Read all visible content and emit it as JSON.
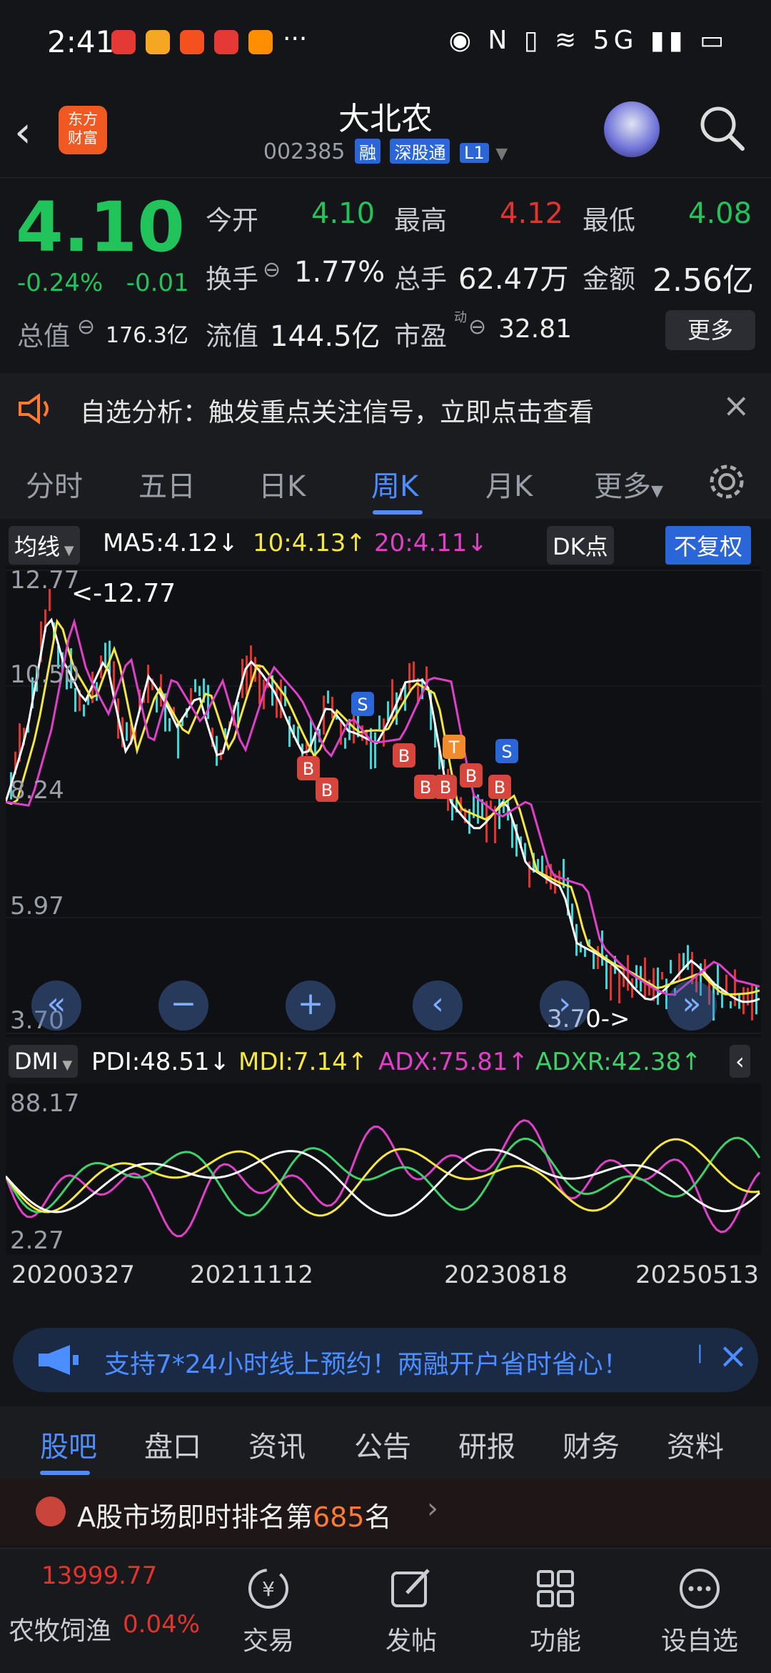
{
  "status": {
    "time": "2:41",
    "icons": "◉ N ▯ ≋ 5G ▮▮ ▭"
  },
  "header": {
    "logo_line1": "东方",
    "logo_line2": "财富",
    "title": "大北农",
    "code": "002385",
    "tag1": "融",
    "tag2": "深股通",
    "tag3": "L1"
  },
  "quote": {
    "price": "4.10",
    "change_pct": "-0.24%",
    "change_abs": "-0.01",
    "open_label": "今开",
    "open": "4.10",
    "high_label": "最高",
    "high": "4.12",
    "low_label": "最低",
    "low": "4.08",
    "turnover_label": "换手",
    "turnover": "1.77%",
    "volume_label": "总手",
    "volume": "62.47万",
    "amount_label": "金额",
    "amount": "2.56亿",
    "mktcap_label": "总值",
    "mktcap": "176.3亿",
    "float_label": "流值",
    "float": "144.5亿",
    "pe_label": "市盈",
    "pe_super": "动",
    "pe": "32.81",
    "more": "更多"
  },
  "notice": {
    "text": "自选分析：触发重点关注信号，立即点击查看"
  },
  "tabs": [
    "分时",
    "五日",
    "日K",
    "周K",
    "月K",
    "更多"
  ],
  "ma": {
    "selector": "均线",
    "ma5": "MA5:4.12↓",
    "ma10": "10:4.13↑",
    "ma20": "20:4.11↓",
    "dk": "DK点",
    "adj": "不复权"
  },
  "chart_labels": {
    "y_top": "12.77",
    "y2": "10.50",
    "y3": "8.24",
    "y4": "5.97",
    "y_bottom": "3.70",
    "max_note": "<-12.77",
    "min_note": "3.70->",
    "signals": [
      "S",
      "B",
      "B",
      "B",
      "B",
      "B",
      "T",
      "S",
      "B",
      "B"
    ]
  },
  "dmi": {
    "selector": "DMI",
    "pdi": "PDI:48.51↓",
    "mdi": "MDI:7.14↑",
    "adx": "ADX:75.81↑",
    "adxr": "ADXR:42.38↑",
    "y_top": "88.17",
    "y_bottom": "2.27"
  },
  "dates": [
    "20200327",
    "20211112",
    "20230818",
    "20250513"
  ],
  "promo": {
    "text": "支持7*24小时线上预约！两融开户省时省心！"
  },
  "bottom_tabs": [
    "股吧",
    "盘口",
    "资讯",
    "公告",
    "研报",
    "财务",
    "资料"
  ],
  "rank": {
    "prefix": "A股市场即时排名第",
    "num": "685",
    "suffix": "名"
  },
  "toolbar": {
    "index_value": "13999.77",
    "index_name": "农牧饲渔",
    "index_change": "0.04%",
    "items": [
      "交易",
      "发帖",
      "功能",
      "设自选"
    ]
  },
  "colors": {
    "up": "#e5322d",
    "down": "#21c45a",
    "accent": "#4c8dff",
    "ma5": "#ffffff",
    "ma10": "#f5e641",
    "ma20": "#e040c8"
  }
}
